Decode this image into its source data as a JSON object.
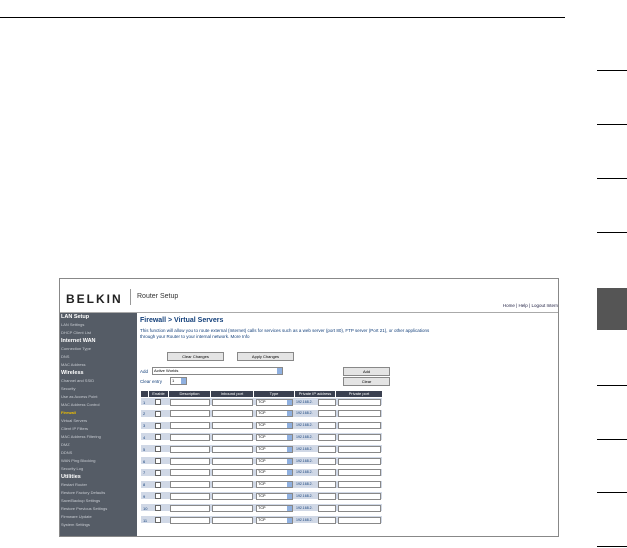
{
  "screenshot": {
    "brand": "BELKIN",
    "router_setup": "Router Setup",
    "top_links": "Home | Help | Logout  Intern",
    "nav": [
      {
        "label": "LAN Setup",
        "head": true
      },
      {
        "label": "LAN Settings"
      },
      {
        "label": "DHCP Client List"
      },
      {
        "label": "Internet WAN",
        "head": true
      },
      {
        "label": "Connection Type"
      },
      {
        "label": "DNS"
      },
      {
        "label": "MAC Address"
      },
      {
        "label": "Wireless",
        "head": true
      },
      {
        "label": "Channel and SSID"
      },
      {
        "label": "Security"
      },
      {
        "label": "Use as Access Point"
      },
      {
        "label": "MAC Address Control"
      },
      {
        "label": "Firewall",
        "active": true
      },
      {
        "label": "Virtual Servers"
      },
      {
        "label": "Client IP Filters"
      },
      {
        "label": "MAC Address Filtering"
      },
      {
        "label": "DMZ"
      },
      {
        "label": "DDNS"
      },
      {
        "label": "WAN Ping Blocking"
      },
      {
        "label": "Security Log"
      },
      {
        "label": "Utilities",
        "head": true
      },
      {
        "label": "Restart Router"
      },
      {
        "label": "Restore Factory Defaults"
      },
      {
        "label": "Save/Backup Settings"
      },
      {
        "label": "Restore Previous Settings"
      },
      {
        "label": "Firmware Update"
      },
      {
        "label": "System Settings"
      }
    ],
    "title": "Firewall > Virtual Servers",
    "description": "This function will allow you to route external (Internet) calls for services such as a web server (port 80), FTP server (Port 21), or other applications through your Router to your internal network. More Info",
    "clear_changes": "Clear Changes",
    "apply_changes": "Apply Changes",
    "add_label": "Add",
    "add_value": "Active Worlds",
    "add_button": "Add",
    "clear_entry_label": "Clear entry",
    "clear_entry_value": "1",
    "clear_button": "Clear",
    "headers": [
      "",
      "Enable",
      "Description",
      "Inbound port",
      "Type",
      "Private IP address",
      "Private port"
    ],
    "rows": [
      {
        "num": "1",
        "type": "TCP",
        "ip": "192.168.2."
      },
      {
        "num": "2",
        "type": "TCP",
        "ip": "192.168.2."
      },
      {
        "num": "3",
        "type": "TCP",
        "ip": "192.168.2."
      },
      {
        "num": "4",
        "type": "TCP",
        "ip": "192.168.2."
      },
      {
        "num": "5",
        "type": "TCP",
        "ip": "192.168.2."
      },
      {
        "num": "6",
        "type": "TCP",
        "ip": "192.168.2."
      },
      {
        "num": "7",
        "type": "TCP",
        "ip": "192.168.2."
      },
      {
        "num": "8",
        "type": "TCP",
        "ip": "192.168.2."
      },
      {
        "num": "9",
        "type": "TCP",
        "ip": "192.168.2."
      },
      {
        "num": "10",
        "type": "TCP",
        "ip": "192.168.2."
      },
      {
        "num": "11",
        "type": "TCP",
        "ip": "192.168.2."
      }
    ]
  }
}
